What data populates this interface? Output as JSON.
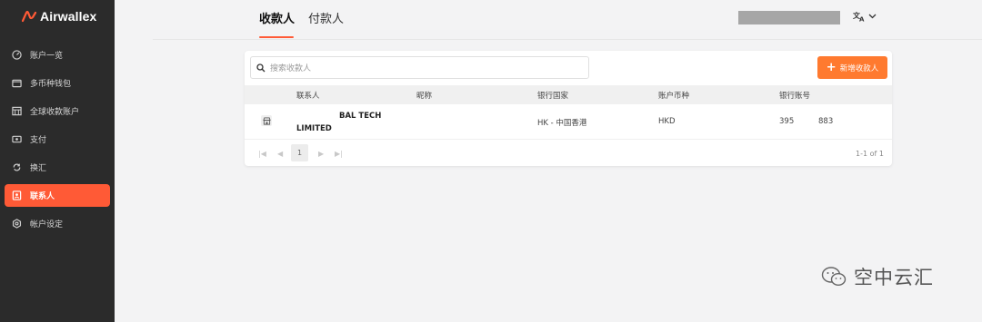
{
  "brand": {
    "name": "Airwallex",
    "accent": "#ff5a36"
  },
  "sidebar": {
    "items": [
      {
        "label": "账户一览",
        "icon": "dashboard-icon"
      },
      {
        "label": "多币种钱包",
        "icon": "wallet-icon"
      },
      {
        "label": "全球收款账户",
        "icon": "bank-icon"
      },
      {
        "label": "支付",
        "icon": "payment-icon"
      },
      {
        "label": "换汇",
        "icon": "exchange-icon"
      },
      {
        "label": "联系人",
        "icon": "contacts-icon",
        "active": true
      },
      {
        "label": "帐户设定",
        "icon": "settings-icon"
      }
    ]
  },
  "tabs": [
    {
      "label": "收款人",
      "active": true
    },
    {
      "label": "付款人",
      "active": false
    }
  ],
  "header": {
    "language_icon": "translate-icon"
  },
  "search": {
    "placeholder": "搜索收款人"
  },
  "toolbar": {
    "add_label": "新增收款人",
    "add_color": "#ff7a2f"
  },
  "table": {
    "columns": [
      "联系人",
      "昵称",
      "银行国家",
      "账户币种",
      "银行账号"
    ],
    "rows": [
      {
        "name_line1": "BAL TECH",
        "name_line2": "LIMITED",
        "nickname": "",
        "country": "HK - 中国香港",
        "currency": "HKD",
        "account_a": "395",
        "account_b": "883"
      }
    ]
  },
  "pagination": {
    "current_page": "1",
    "summary": "1-1 of 1"
  },
  "watermark": {
    "text": "空中云汇"
  }
}
